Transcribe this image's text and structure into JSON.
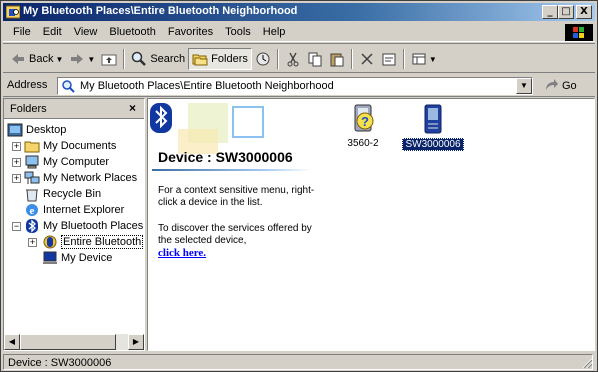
{
  "window": {
    "title": "My Bluetooth Places\\Entire Bluetooth Neighborhood",
    "buttons": {
      "minimize": "_",
      "maximize": "□",
      "close": "X"
    }
  },
  "menu": {
    "items": [
      {
        "label": "File"
      },
      {
        "label": "Edit"
      },
      {
        "label": "View"
      },
      {
        "label": "Bluetooth"
      },
      {
        "label": "Favorites"
      },
      {
        "label": "Tools"
      },
      {
        "label": "Help"
      }
    ]
  },
  "toolbar": {
    "back_label": "Back",
    "search_label": "Search",
    "folders_label": "Folders"
  },
  "address": {
    "label": "Address",
    "value": "My Bluetooth Places\\Entire Bluetooth Neighborhood",
    "go_label": "Go"
  },
  "folders": {
    "header": "Folders",
    "close": "×",
    "tree": [
      {
        "label": "Desktop"
      },
      {
        "label": "My Documents"
      },
      {
        "label": "My Computer"
      },
      {
        "label": "My Network Places"
      },
      {
        "label": "Recycle Bin"
      },
      {
        "label": "Internet Explorer"
      },
      {
        "label": "My Bluetooth Places"
      },
      {
        "label": "Entire Bluetooth"
      },
      {
        "label": "My Device"
      }
    ]
  },
  "content": {
    "device_title": "Device : SW3000006",
    "hint1": "For a context sensitive menu, right-click a device in the list.",
    "hint2": "To discover the services offered by the selected device,",
    "link": "click here.",
    "items": [
      {
        "label": "3560-2"
      },
      {
        "label": "SW3000006"
      }
    ]
  },
  "status": {
    "text": "Device : SW3000006"
  }
}
